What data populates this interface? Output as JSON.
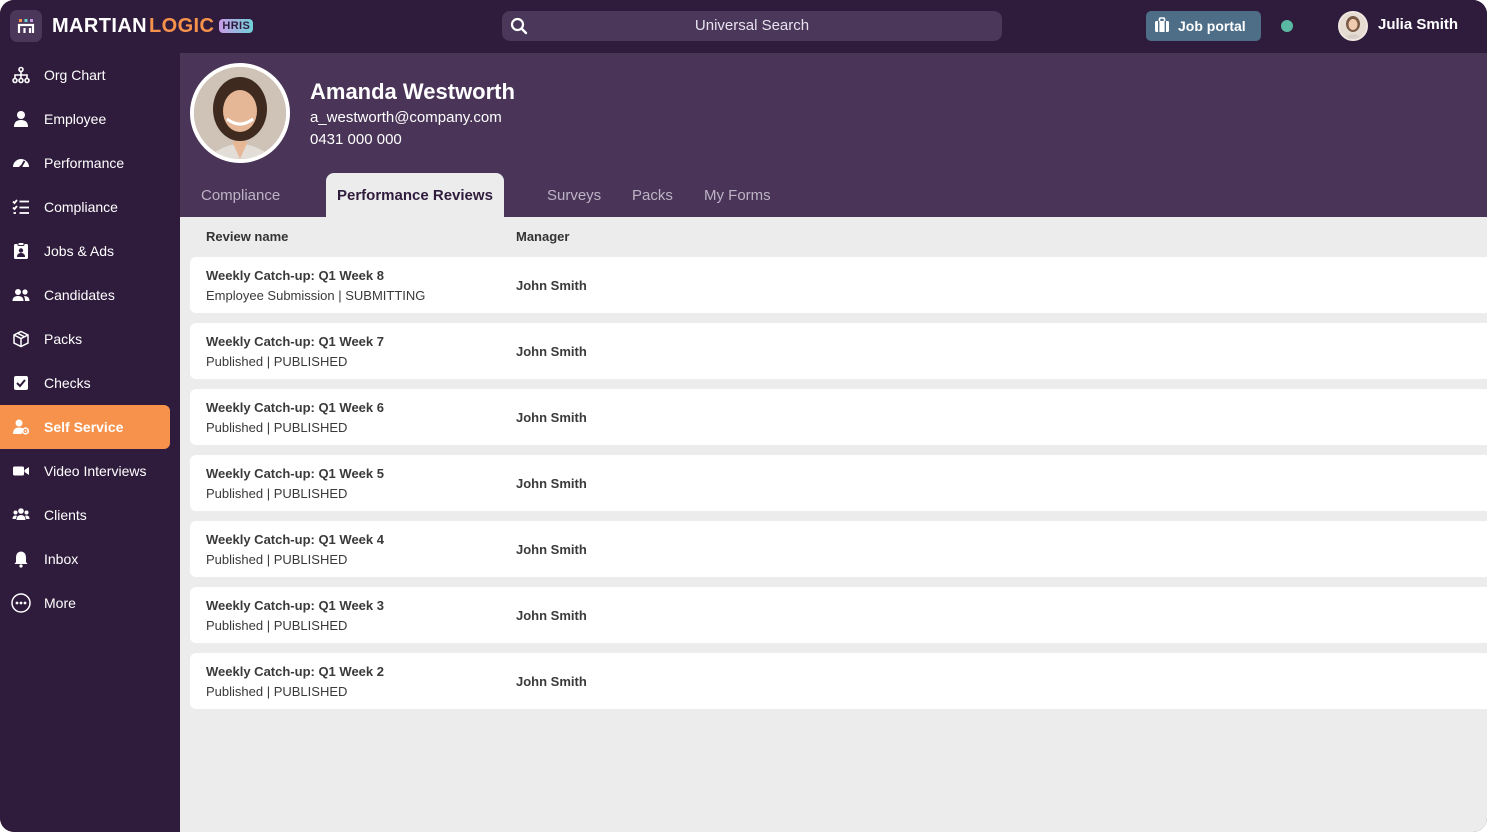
{
  "brand": {
    "name_part1": "MARTIAN",
    "name_part2": "LOGIC",
    "badge": "HRIS",
    "accent": "#f6924b",
    "bg": "#2f1c3d"
  },
  "header": {
    "search_placeholder": "Universal Search",
    "job_portal_label": "Job portal",
    "user_name": "Julia Smith",
    "status_color": "#5ab8a3"
  },
  "sidebar": {
    "items": [
      {
        "label": "Org Chart",
        "icon": "org-chart-icon",
        "active": false
      },
      {
        "label": "Employee",
        "icon": "employee-icon",
        "active": false
      },
      {
        "label": "Performance",
        "icon": "performance-icon",
        "active": false
      },
      {
        "label": "Compliance",
        "icon": "compliance-icon",
        "active": false
      },
      {
        "label": "Jobs & Ads",
        "icon": "jobs-icon",
        "active": false
      },
      {
        "label": "Candidates",
        "icon": "candidates-icon",
        "active": false
      },
      {
        "label": "Packs",
        "icon": "packs-icon",
        "active": false
      },
      {
        "label": "Checks",
        "icon": "checks-icon",
        "active": false
      },
      {
        "label": "Self Service",
        "icon": "self-service-icon",
        "active": true
      },
      {
        "label": "Video Interviews",
        "icon": "video-icon",
        "active": false
      },
      {
        "label": "Clients",
        "icon": "clients-icon",
        "active": false
      },
      {
        "label": "Inbox",
        "icon": "bell-icon",
        "active": false
      },
      {
        "label": "More",
        "icon": "more-icon",
        "active": false
      }
    ]
  },
  "profile": {
    "name": "Amanda Westworth",
    "email": "a_westworth@company.com",
    "phone": "0431 000 000"
  },
  "tabs": [
    {
      "label": "Compliance",
      "active": false
    },
    {
      "label": "Performance Reviews",
      "active": true
    },
    {
      "label": "Surveys",
      "active": false
    },
    {
      "label": "Packs",
      "active": false
    },
    {
      "label": "My Forms",
      "active": false
    }
  ],
  "table": {
    "columns": [
      "Review name",
      "Manager"
    ],
    "rows": [
      {
        "title": "Weekly Catch-up: Q1 Week 8",
        "status": "Employee Submission | SUBMITTING",
        "manager": "John Smith"
      },
      {
        "title": "Weekly Catch-up: Q1 Week 7",
        "status": "Published | PUBLISHED",
        "manager": "John Smith"
      },
      {
        "title": "Weekly Catch-up: Q1 Week 6",
        "status": "Published | PUBLISHED",
        "manager": "John Smith"
      },
      {
        "title": "Weekly Catch-up: Q1 Week 5",
        "status": "Published | PUBLISHED",
        "manager": "John Smith"
      },
      {
        "title": "Weekly Catch-up: Q1 Week 4",
        "status": "Published | PUBLISHED",
        "manager": "John Smith"
      },
      {
        "title": "Weekly Catch-up: Q1 Week 3",
        "status": "Published | PUBLISHED",
        "manager": "John Smith"
      },
      {
        "title": "Weekly Catch-up: Q1 Week 2",
        "status": "Published | PUBLISHED",
        "manager": "John Smith"
      }
    ]
  }
}
